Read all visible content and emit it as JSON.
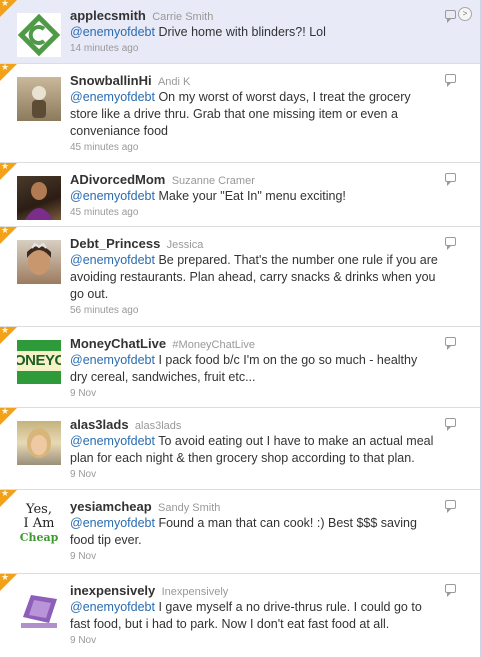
{
  "colors": {
    "favorite_accent": "#f4a11a",
    "highlight_background": "#e8eaf8",
    "mention_link": "#2a6cb0"
  },
  "icons": {
    "favorite": "star-icon",
    "reply": "reply-icon",
    "more": "chevron-right-icon"
  },
  "tweets": [
    {
      "screen_name": "applecsmith",
      "full_name": "Carrie Smith",
      "mention": "@enemyofdebt",
      "text": "Drive home with blinders?! Lol",
      "time": "14 minutes ago",
      "avatar_text": ""
    },
    {
      "screen_name": "SnowballinHi",
      "full_name": "Andi K",
      "mention": "@enemyofdebt",
      "text": "On my worst of worst days, I treat the grocery store like a drive thru. Grab that one missing item or even a conveniance food",
      "time": "45 minutes ago",
      "avatar_text": ""
    },
    {
      "screen_name": "ADivorcedMom",
      "full_name": "Suzanne Cramer",
      "mention": "@enemyofdebt",
      "text": "Make your \"Eat In\" menu exciting!",
      "time": "45 minutes ago",
      "avatar_text": ""
    },
    {
      "screen_name": "Debt_Princess",
      "full_name": "Jessica",
      "mention": "@enemyofdebt",
      "text": "Be prepared. That's the number one rule if you are avoiding restaurants. Plan ahead, carry snacks & drinks when you go out.",
      "time": "56 minutes ago",
      "avatar_text": ""
    },
    {
      "screen_name": "MoneyChatLive",
      "full_name": "#MoneyChatLive",
      "mention": "@enemyofdebt",
      "text": "I pack food b/c I'm on the go so much - healthy dry cereal, sandwiches, fruit etc...",
      "time": "9 Nov",
      "avatar_text": "ONEYC"
    },
    {
      "screen_name": "alas3lads",
      "full_name": "alas3lads",
      "mention": "@enemyofdebt",
      "text": "To avoid eating out I have to make an actual meal plan for each night & then grocery shop according to that plan.",
      "time": "9 Nov",
      "avatar_text": ""
    },
    {
      "screen_name": "yesiamcheap",
      "full_name": "Sandy Smith",
      "mention": "@enemyofdebt",
      "text": "Found a man that can cook! :) Best $$$ saving food tip ever.",
      "time": "9 Nov",
      "avatar_text": [
        "Yes,",
        "I Am",
        "Cheap"
      ]
    },
    {
      "screen_name": "inexpensively",
      "full_name": "Inexpensively",
      "mention": "@enemyofdebt",
      "text": "I gave myself a no drive-thrus rule. I could go to fast food, but i had to park. Now I don't eat fast food at all.",
      "time": "9 Nov",
      "avatar_text": ""
    }
  ]
}
